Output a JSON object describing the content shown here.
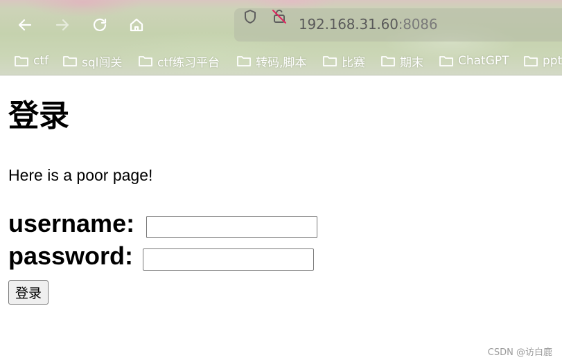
{
  "browser": {
    "url_host": "192.168.31.60",
    "url_port": ":8086",
    "bookmarks": [
      {
        "label": "ctf"
      },
      {
        "label": "sql闯关"
      },
      {
        "label": "ctf练习平台"
      },
      {
        "label": "转码,脚本"
      },
      {
        "label": "比赛"
      },
      {
        "label": "期末"
      },
      {
        "label": "ChatGPT"
      },
      {
        "label": "ppt"
      }
    ],
    "icons": {
      "back": "back-arrow-icon",
      "forward": "forward-arrow-icon",
      "reload": "reload-icon",
      "home": "home-icon",
      "shield": "shield-icon",
      "insecure_lock": "insecure-lock-icon",
      "folder": "folder-icon"
    }
  },
  "page": {
    "title": "登录",
    "intro": "Here is a poor page!",
    "username_label": "username:",
    "username_value": "",
    "password_label": "password:",
    "password_value": "",
    "submit_label": "登录"
  },
  "watermark": "CSDN @访白鹿",
  "colors": {
    "insecure_lock": "#e0245e",
    "button_bg": "#efefef",
    "input_border": "#767676"
  }
}
